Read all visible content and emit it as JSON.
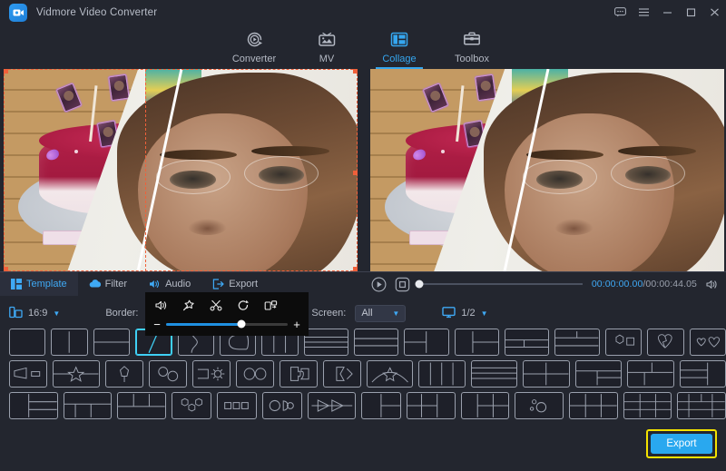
{
  "app": {
    "title": "Vidmore Video Converter",
    "logo_icon": "video-camera-icon"
  },
  "window_controls": [
    {
      "name": "feedback-icon",
      "glyph": "chat-bubble"
    },
    {
      "name": "menu-icon",
      "glyph": "hamburger"
    },
    {
      "name": "minimize-icon",
      "glyph": "minimize"
    },
    {
      "name": "maximize-icon",
      "glyph": "maximize"
    },
    {
      "name": "close-icon",
      "glyph": "close"
    }
  ],
  "nav_tabs": [
    {
      "label": "Converter",
      "icon": "converter-icon",
      "active": false
    },
    {
      "label": "MV",
      "icon": "mv-icon",
      "active": false
    },
    {
      "label": "Collage",
      "icon": "collage-icon",
      "active": true
    },
    {
      "label": "Toolbox",
      "icon": "toolbox-icon",
      "active": false
    }
  ],
  "clip_toolbar": {
    "icons": [
      "volume-icon",
      "magic-wand-icon",
      "trim-scissors-icon",
      "rotate-icon",
      "crop-replace-icon"
    ],
    "zoom_out_label": "−",
    "zoom_in_label": "+",
    "slider_value": 62
  },
  "edit_tabs": [
    {
      "label": "Template",
      "icon": "template-icon",
      "active": true
    },
    {
      "label": "Filter",
      "icon": "filter-icon",
      "active": false
    },
    {
      "label": "Audio",
      "icon": "audio-icon",
      "active": false
    },
    {
      "label": "Export",
      "icon": "export-icon",
      "active": false
    }
  ],
  "player": {
    "play_icon": "play-icon",
    "stop_icon": "stop-icon",
    "volume_icon": "volume-icon",
    "current_time": "00:00:00.00",
    "total_time": "/00:00:44.05",
    "progress": 0
  },
  "options": {
    "ratio_icon": "aspect-ratio-icon",
    "ratio_value": "16:9",
    "border_label": "Border:",
    "border_style": "solid-line",
    "grid_icon": "grid-dots-icon",
    "pattern_icon": "hatch-pattern-icon",
    "screen_label": "Screen:",
    "screen_value": "All",
    "monitor_icon": "monitor-icon",
    "page_value": "1/2"
  },
  "templates": {
    "selected_index": 3,
    "rows": [
      [
        "single-full",
        "two-vertical",
        "two-horizontal",
        "diagonal-split",
        "bite-shape",
        "rounded-blob",
        "three-columns",
        "three-rows-thin",
        "three-rows",
        "left-big-right-split",
        "left-split-right-split",
        "top-split-bottom-wide",
        "top-wide-bottom-split",
        "hexagon-square",
        "broken-heart",
        "two-hearts"
      ],
      [
        "megaphone",
        "star-banner",
        "pentagon-shield",
        "two-circles",
        "flag-sun",
        "two-ovals",
        "puzzle-pieces",
        "cross-arrow",
        "arch-star",
        "four-columns",
        "four-rows",
        "four-grid",
        "grid-offset-left",
        "grid-offset-mix",
        "grid-left-stack"
      ],
      [
        "left-pane-two-rows",
        "top-wide-three-bottom",
        "three-top-one-bottom",
        "three-hexagons",
        "three-squares",
        "circle-pair",
        "arrow-strip",
        "split-stack",
        "six-grid-left",
        "six-grid-mixed",
        "bubbles",
        "six-grid",
        "nine-grid",
        "nine-grid-wide"
      ]
    ]
  },
  "export": {
    "label": "Export",
    "highlight_color": "#f4e200",
    "button_color": "#29a8ef"
  }
}
